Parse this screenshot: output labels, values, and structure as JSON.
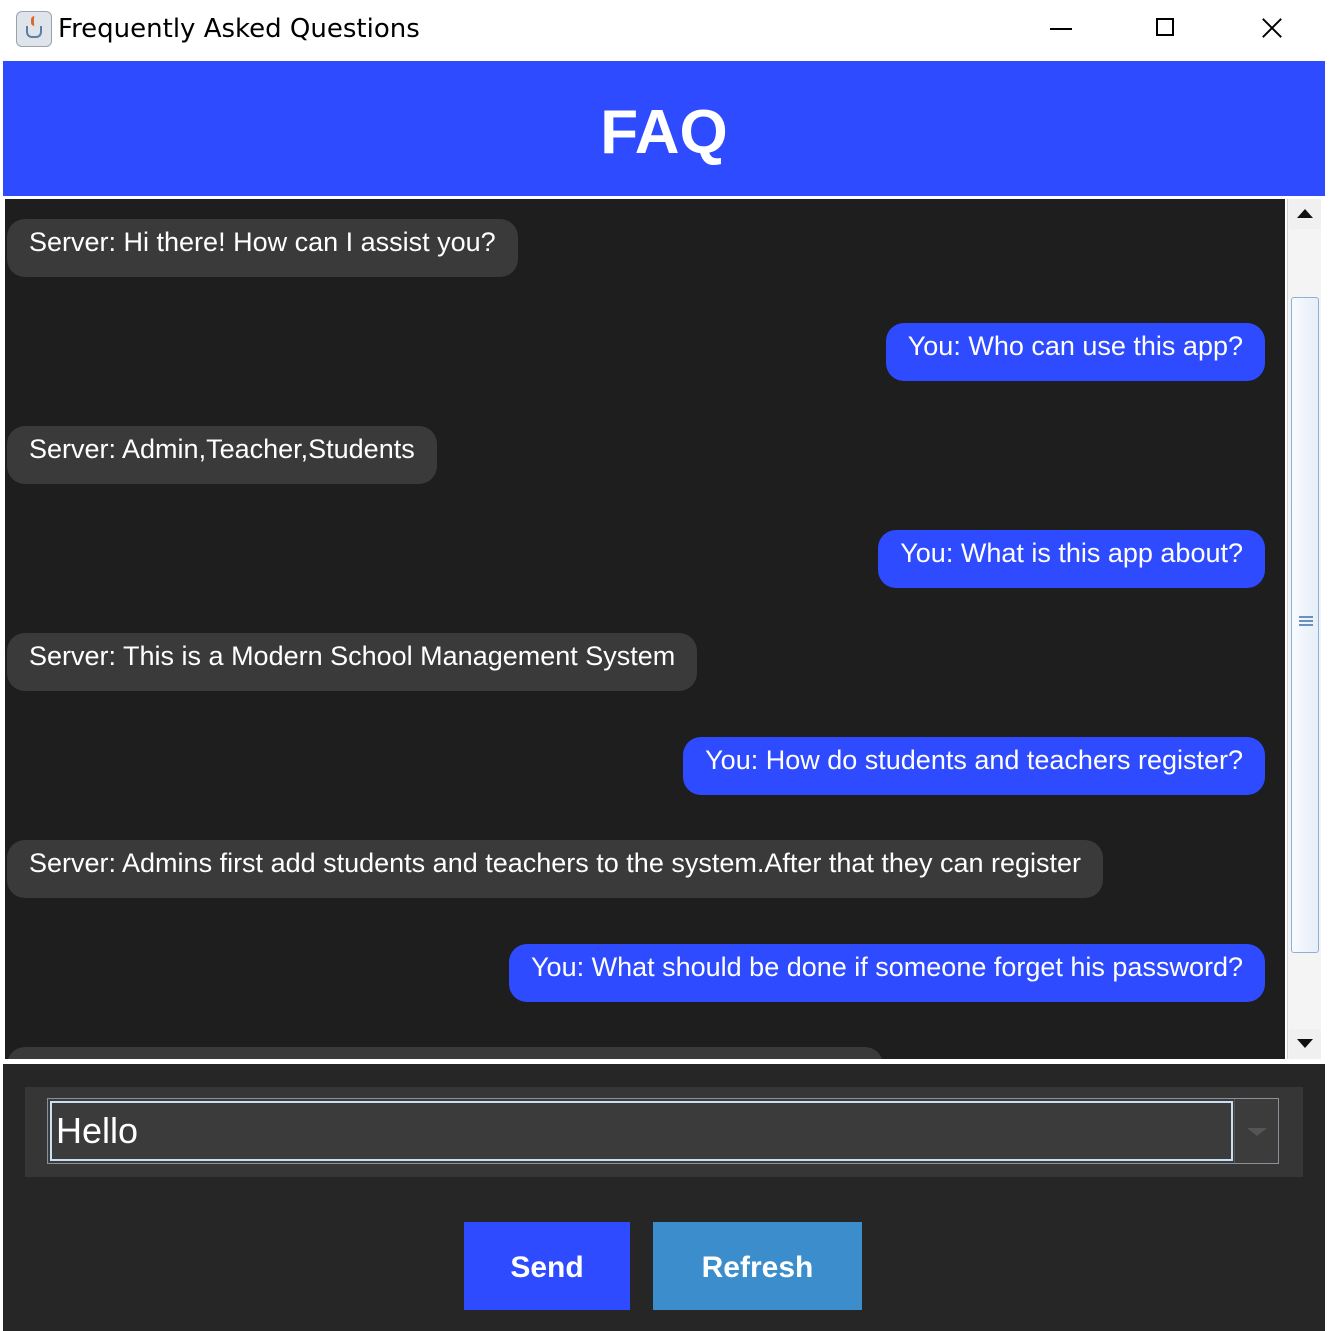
{
  "window": {
    "title": "Frequently Asked Questions",
    "controls": [
      "minimize",
      "maximize",
      "close"
    ]
  },
  "header": {
    "title": "FAQ",
    "color": "#2e4bff"
  },
  "chat": {
    "messages": [
      {
        "sender": "server",
        "text": "Server: Hi there! How can I assist you?"
      },
      {
        "sender": "you",
        "text": "You: Who can use this app?"
      },
      {
        "sender": "server",
        "text": "Server: Admin,Teacher,Students"
      },
      {
        "sender": "you",
        "text": "You: What is this app about?"
      },
      {
        "sender": "server",
        "text": "Server: This is a Modern School Management System"
      },
      {
        "sender": "you",
        "text": "You: How do students and teachers register?"
      },
      {
        "sender": "server",
        "text": "Server: Admins first add students and teachers to the system.After that they can register"
      },
      {
        "sender": "you",
        "text": "You: What should be done if someone forget his password?"
      }
    ],
    "server_bubble_color": "#3a3a3a",
    "you_bubble_color": "#2e4bff"
  },
  "input": {
    "value": "Hello"
  },
  "buttons": {
    "send_label": "Send",
    "refresh_label": "Refresh",
    "send_color": "#2e4bff",
    "refresh_color": "#3c8dcc"
  },
  "icons": [
    "java-app-icon",
    "minimize-icon",
    "maximize-icon",
    "close-icon",
    "scroll-up-icon",
    "scroll-down-icon",
    "scrollbar-grip-icon",
    "dropdown-arrow-icon"
  ]
}
